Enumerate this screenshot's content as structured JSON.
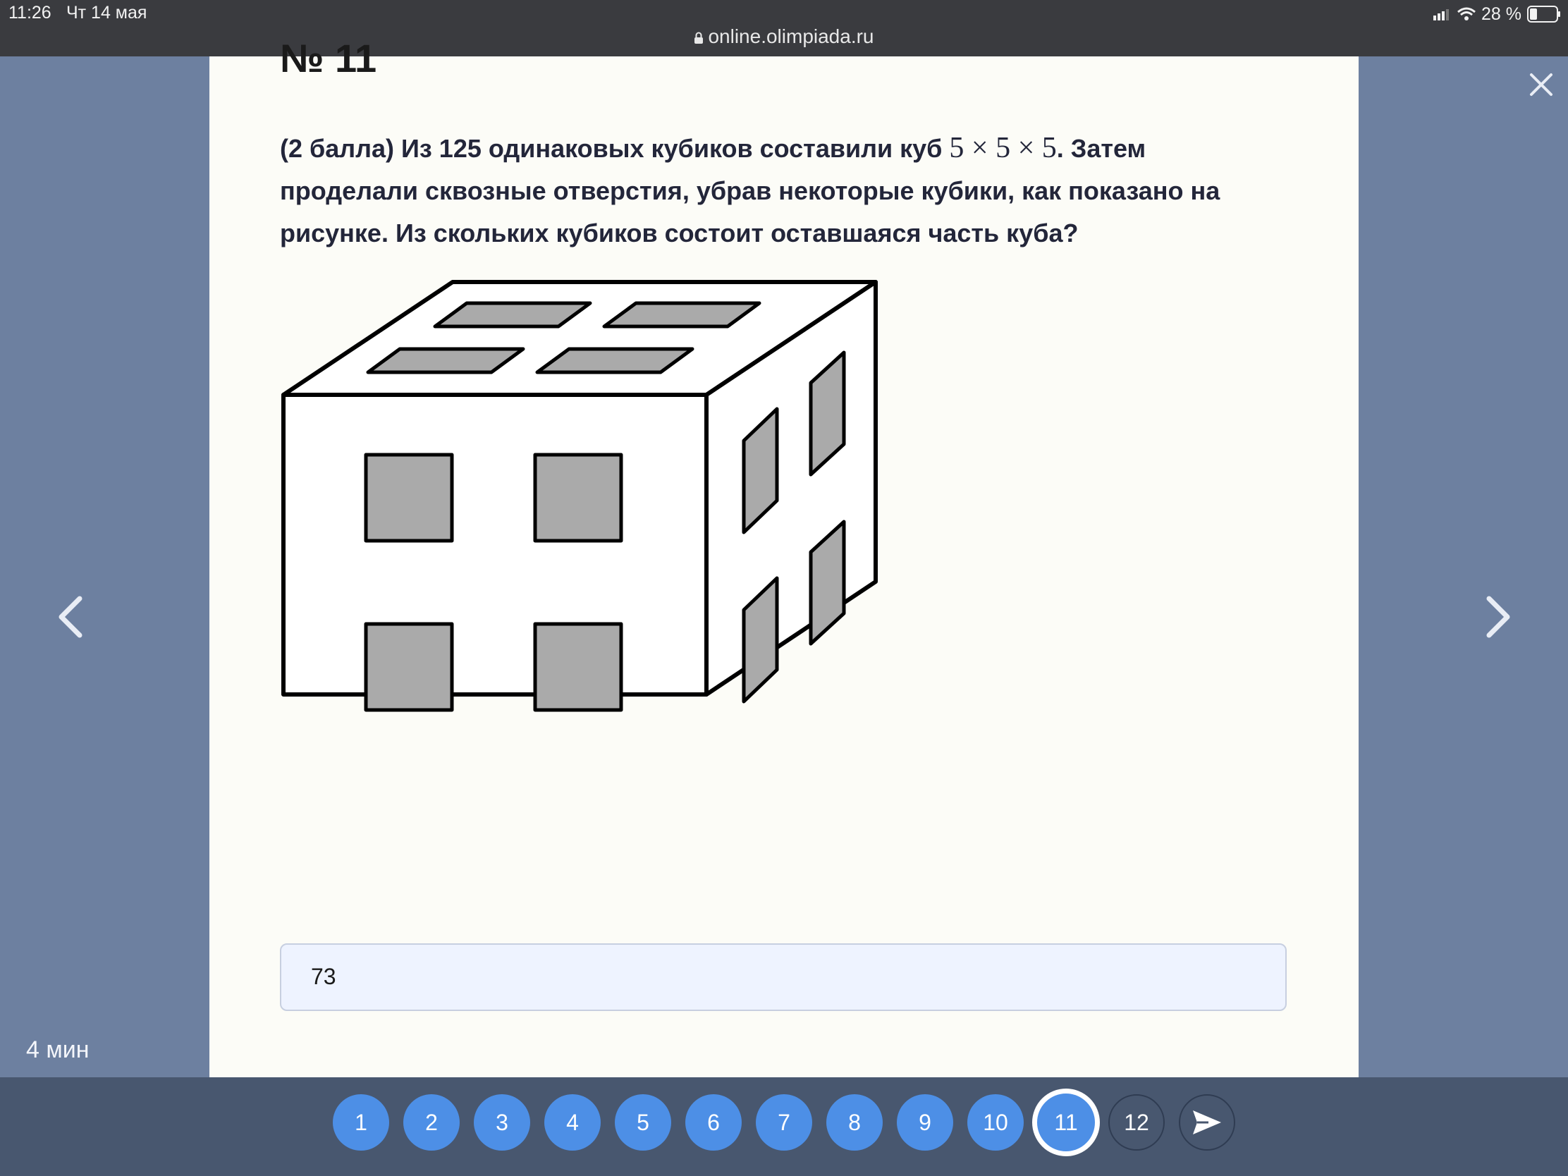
{
  "status_bar": {
    "time": "11:26",
    "date": "Чт 14 мая",
    "url": "online.olimpiada.ru",
    "battery": "28 %"
  },
  "question": {
    "number_label": "№ 11",
    "text_part1": "(2 балла) Из 125 одинаковых кубиков составили куб ",
    "math": "5 × 5 × 5",
    "text_part2": ". Затем проделали сквозные отверстия, убрав некоторые кубики, как показано на рисунке. Из скольких кубиков состоит оставшаяся часть куба?"
  },
  "answer": {
    "value": "73"
  },
  "timer": "4 мин",
  "nav": {
    "questions": [
      {
        "label": "1",
        "state": "answered"
      },
      {
        "label": "2",
        "state": "answered"
      },
      {
        "label": "3",
        "state": "answered"
      },
      {
        "label": "4",
        "state": "answered"
      },
      {
        "label": "5",
        "state": "answered"
      },
      {
        "label": "6",
        "state": "answered"
      },
      {
        "label": "7",
        "state": "answered"
      },
      {
        "label": "8",
        "state": "answered"
      },
      {
        "label": "9",
        "state": "answered"
      },
      {
        "label": "10",
        "state": "answered"
      },
      {
        "label": "11",
        "state": "current"
      },
      {
        "label": "12",
        "state": "pending"
      }
    ],
    "send_icon": "send-icon",
    "close_icon": "close-icon",
    "prev_icon": "chevron-left-icon",
    "next_icon": "chevron-right-icon"
  },
  "colors": {
    "page_bg": "#6d80a0",
    "card_bg": "#fcfcf7",
    "bottom_bar": "#48576f",
    "accent": "#4d8fe6",
    "hole_fill": "#aaaaaa"
  }
}
